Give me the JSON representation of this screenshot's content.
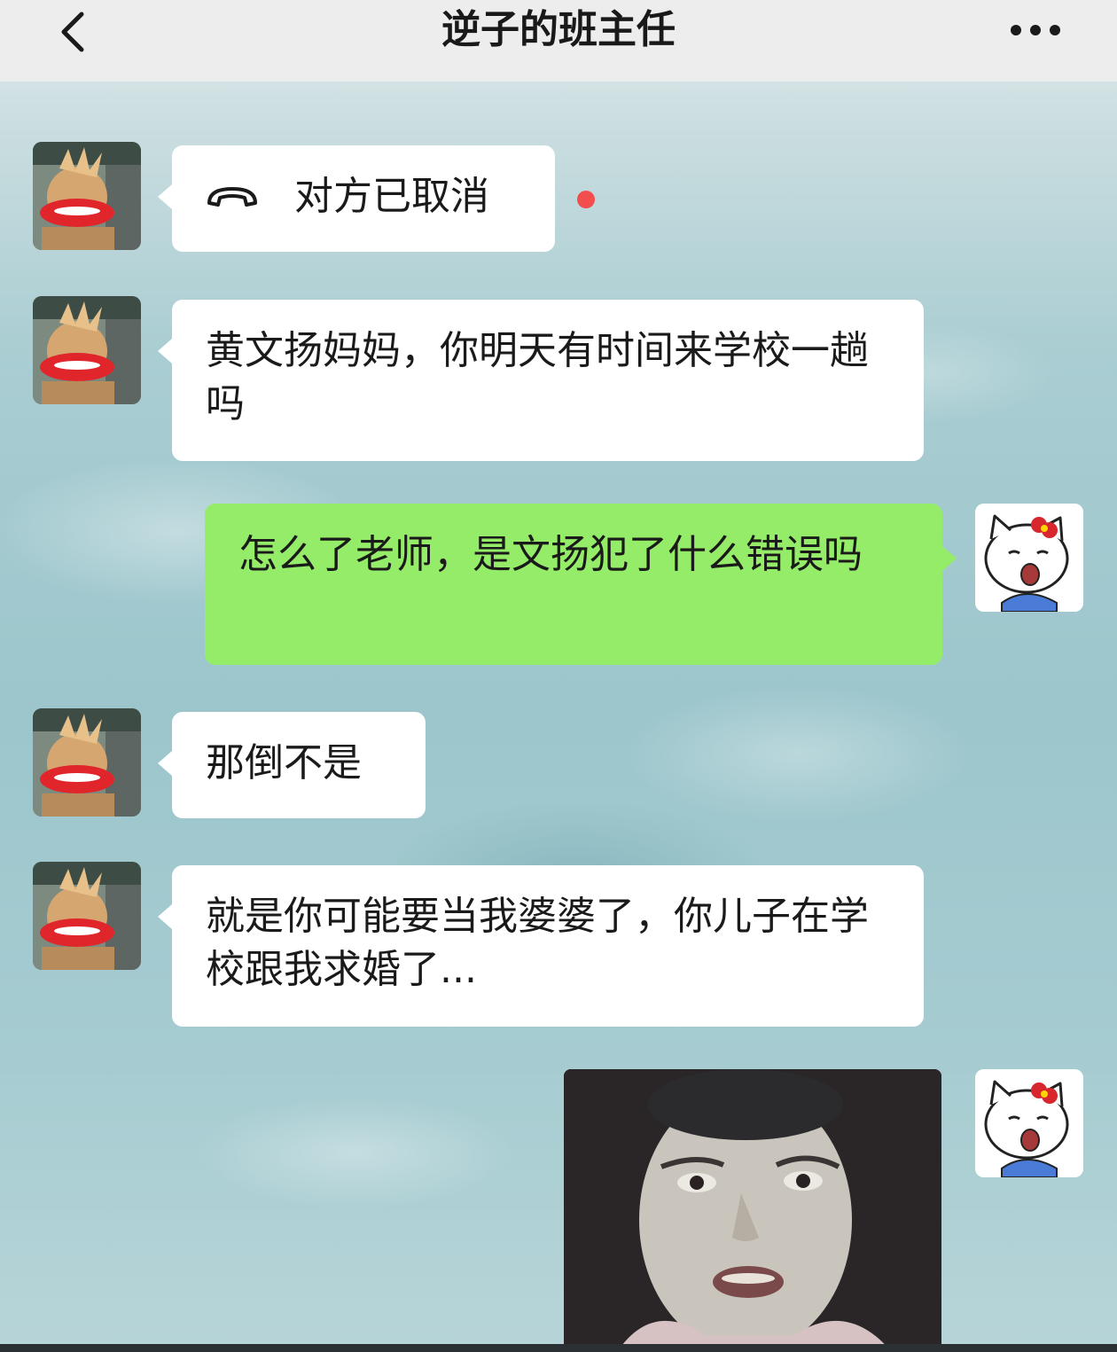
{
  "header": {
    "title": "逆子的班主任",
    "back_icon": "chevron-left-icon",
    "more_icon": "more-dots-icon"
  },
  "messages": [
    {
      "sender": "teacher",
      "type": "call",
      "icon": "hang-up-phone-icon",
      "text": "对方已取消",
      "unread": true
    },
    {
      "sender": "teacher",
      "type": "text",
      "text": "黄文扬妈妈，你明天有时间来学校一趟吗"
    },
    {
      "sender": "me",
      "type": "text",
      "text": "怎么了老师，是文扬犯了什么错误吗"
    },
    {
      "sender": "teacher",
      "type": "text",
      "text": "那倒不是"
    },
    {
      "sender": "teacher",
      "type": "text",
      "text": "就是你可能要当我婆婆了，你儿子在学校跟我求婚了..."
    },
    {
      "sender": "me",
      "type": "sticker",
      "description": ""
    }
  ],
  "colors": {
    "header_bg": "#ededed",
    "bubble_received": "#ffffff",
    "bubble_sent": "#95ec69",
    "unread_dot": "#f24e4e"
  }
}
